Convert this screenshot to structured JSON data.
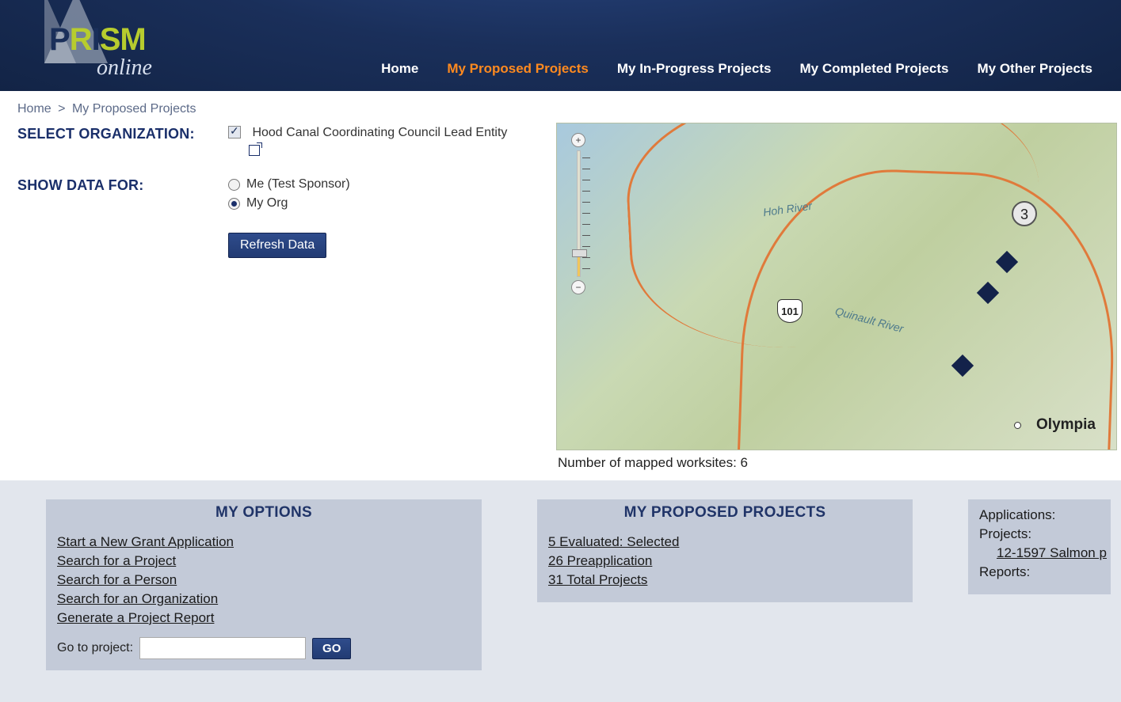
{
  "logo": {
    "prism": "PRISM",
    "online": "online"
  },
  "nav": {
    "home": "Home",
    "proposed": "My Proposed Projects",
    "inprogress": "My In-Progress Projects",
    "completed": "My Completed Projects",
    "other": "My Other Projects"
  },
  "breadcrumb": {
    "home": "Home",
    "sep": ">",
    "current": "My Proposed Projects"
  },
  "filters": {
    "select_org_label": "SELECT ORGANIZATION:",
    "org_name": "Hood Canal Coordinating Council Lead Entity",
    "show_data_label": "SHOW DATA FOR:",
    "radio_me": "Me (Test Sponsor)",
    "radio_myorg": "My Org",
    "refresh_btn": "Refresh Data"
  },
  "map": {
    "highway_shield": "101",
    "cluster_count": "3",
    "city": "Olympia",
    "river1": "Hoh River",
    "river2": "Quinault River",
    "caption": "Number of mapped worksites: 6"
  },
  "panels": {
    "options": {
      "title": "MY OPTIONS",
      "links": [
        "Start a New Grant Application",
        "Search for a Project",
        "Search for a Person",
        "Search for an Organization",
        "Generate a Project Report"
      ],
      "goto_label": "Go to project:",
      "go_btn": "GO"
    },
    "proposed": {
      "title": "MY PROPOSED PROJECTS",
      "links": [
        "5 Evaluated: Selected",
        "26 Preapplication",
        "31 Total Projects"
      ]
    },
    "side": {
      "applications": "Applications:",
      "projects": "Projects:",
      "project_link": "12-1597 Salmon p",
      "reports": "Reports:"
    }
  }
}
